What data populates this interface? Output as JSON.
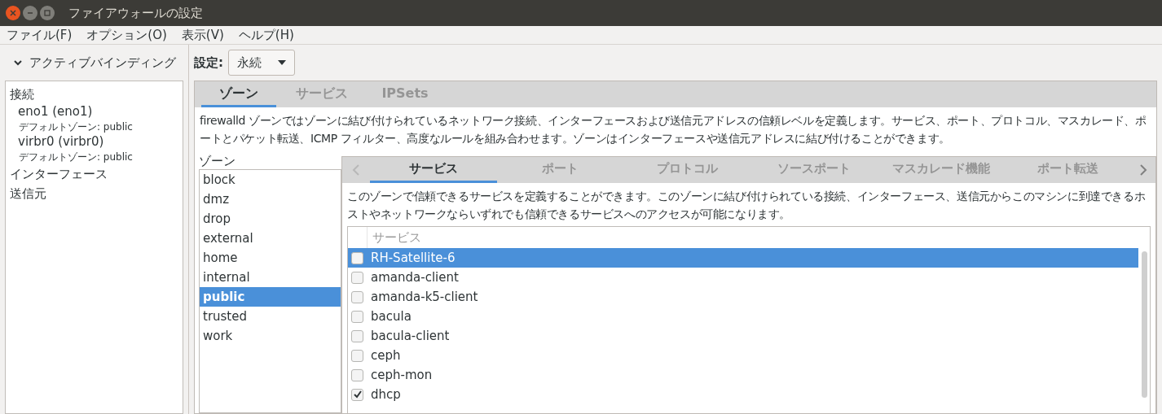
{
  "window": {
    "title": "ファイアウォールの設定"
  },
  "menu": [
    "ファイル(F)",
    "オプション(O)",
    "表示(V)",
    "ヘルプ(H)"
  ],
  "sidebar": {
    "heading": "アクティブバインディング",
    "expanded": true,
    "sections": [
      {
        "label": "接続",
        "items": [
          {
            "name": "eno1 (eno1)",
            "detail": "デフォルトゾーン: public"
          },
          {
            "name": "virbr0 (virbr0)",
            "detail": "デフォルトゾーン: public"
          }
        ]
      },
      {
        "label": "インターフェース"
      },
      {
        "label": "送信元"
      }
    ]
  },
  "config": {
    "label": "設定:",
    "value": "永続"
  },
  "tabs": [
    {
      "label": "ゾーン",
      "selected": true
    },
    {
      "label": "サービス",
      "selected": false
    },
    {
      "label": "IPSets",
      "selected": false
    }
  ],
  "description": "firewalld ゾーンではゾーンに結び付けられているネットワーク接続、インターフェースおよび送信元アドレスの信頼レベルを定義します。サービス、ポート、プロトコル、マスカレード、ポートとパケット転送、ICMP フィルター、高度なルールを組み合わせます。ゾーンはインターフェースや送信元アドレスに結び付けることができます。",
  "zones": {
    "label": "ゾーン",
    "items": [
      {
        "name": "block",
        "selected": false
      },
      {
        "name": "dmz",
        "selected": false
      },
      {
        "name": "drop",
        "selected": false
      },
      {
        "name": "external",
        "selected": false
      },
      {
        "name": "home",
        "selected": false
      },
      {
        "name": "internal",
        "selected": false
      },
      {
        "name": "public",
        "selected": true
      },
      {
        "name": "trusted",
        "selected": false
      },
      {
        "name": "work",
        "selected": false
      }
    ]
  },
  "zone_tabs": [
    {
      "label": "サービス",
      "selected": true
    },
    {
      "label": "ポート",
      "selected": false
    },
    {
      "label": "プロトコル",
      "selected": false
    },
    {
      "label": "ソースポート",
      "selected": false
    },
    {
      "label": "マスカレード機能",
      "selected": false
    },
    {
      "label": "ポート転送",
      "selected": false
    }
  ],
  "zone_description": "このゾーンで信頼できるサービスを定義することができます。このゾーンに結び付けられている接続、インターフェース、送信元からこのマシンに到達できるホストやネットワークならいずれでも信頼できるサービスへのアクセスが可能になります。",
  "services": {
    "column": "サービス",
    "rows": [
      {
        "name": "RH-Satellite-6",
        "checked": false,
        "selected": true
      },
      {
        "name": "amanda-client",
        "checked": false,
        "selected": false
      },
      {
        "name": "amanda-k5-client",
        "checked": false,
        "selected": false
      },
      {
        "name": "bacula",
        "checked": false,
        "selected": false
      },
      {
        "name": "bacula-client",
        "checked": false,
        "selected": false
      },
      {
        "name": "ceph",
        "checked": false,
        "selected": false
      },
      {
        "name": "ceph-mon",
        "checked": false,
        "selected": false
      },
      {
        "name": "dhcp",
        "checked": true,
        "selected": false
      }
    ]
  }
}
